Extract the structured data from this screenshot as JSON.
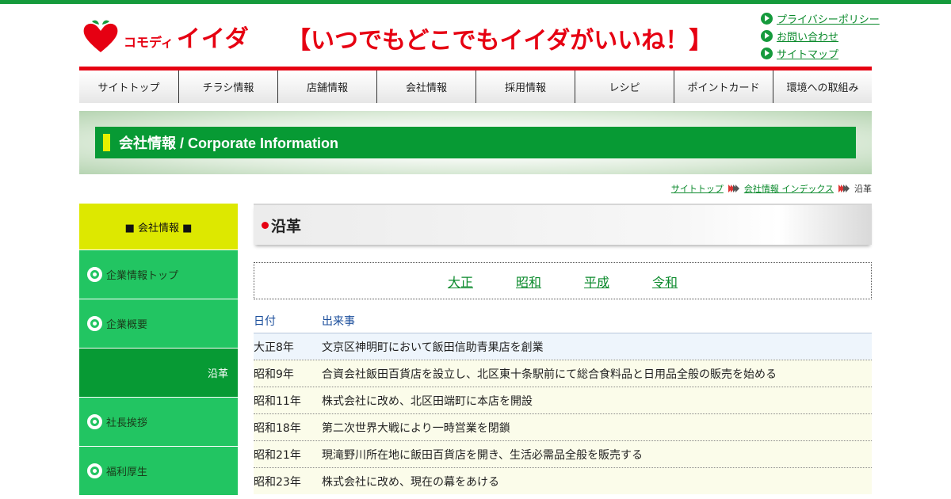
{
  "header": {
    "logo_small": "コモディ",
    "logo_main": "イイダ",
    "tagline": "【いつでもどこでもイイダがいいね！】",
    "links": [
      {
        "label": "プライバシーポリシー",
        "icon": "arrow-circle-icon"
      },
      {
        "label": "お問い合わせ",
        "icon": "arrow-circle-icon"
      },
      {
        "label": "サイトマップ",
        "icon": "arrow-circle-icon"
      }
    ]
  },
  "nav": [
    "サイトトップ",
    "チラシ情報",
    "店舗情報",
    "会社情報",
    "採用情報",
    "レシピ",
    "ポイントカード",
    "環境への取組み"
  ],
  "banner": {
    "title": "会社情報 / Corporate Information"
  },
  "breadcrumb": {
    "items": [
      "サイトトップ",
      "会社情報 インデックス"
    ],
    "current": "沿革"
  },
  "sidebar": {
    "heading": "■ 会社情報 ■",
    "items": [
      {
        "label": "企業情報トップ",
        "active": false
      },
      {
        "label": "企業概要",
        "active": false
      },
      {
        "label": "沿革",
        "active": true
      },
      {
        "label": "社長挨拶",
        "active": false
      },
      {
        "label": "福利厚生",
        "active": false
      }
    ]
  },
  "main": {
    "title": "沿革",
    "eras": [
      "大正",
      "昭和",
      "平成",
      "令和"
    ],
    "history": {
      "col_date": "日付",
      "col_event": "出来事",
      "rows": [
        {
          "date": "大正8年",
          "event": "文京区神明町において飯田信助青果店を創業"
        },
        {
          "date": "昭和9年",
          "event": "合資会社飯田百貨店を設立し、北区東十条駅前にて総合食料品と日用品全般の販売を始める"
        },
        {
          "date": "昭和11年",
          "event": "株式会社に改め、北区田端町に本店を開設"
        },
        {
          "date": "昭和18年",
          "event": "第二次世界大戦により一時営業を閉鎖"
        },
        {
          "date": "昭和21年",
          "event": "現滝野川所在地に飯田百貨店を開き、生活必需品全般を販売する"
        },
        {
          "date": "昭和23年",
          "event": "株式会社に改め、現在の幕をあける"
        }
      ]
    }
  },
  "colors": {
    "brand_red": "#e60012",
    "brand_green": "#079a34",
    "side_green": "#22c562",
    "side_head": "#dde800"
  }
}
